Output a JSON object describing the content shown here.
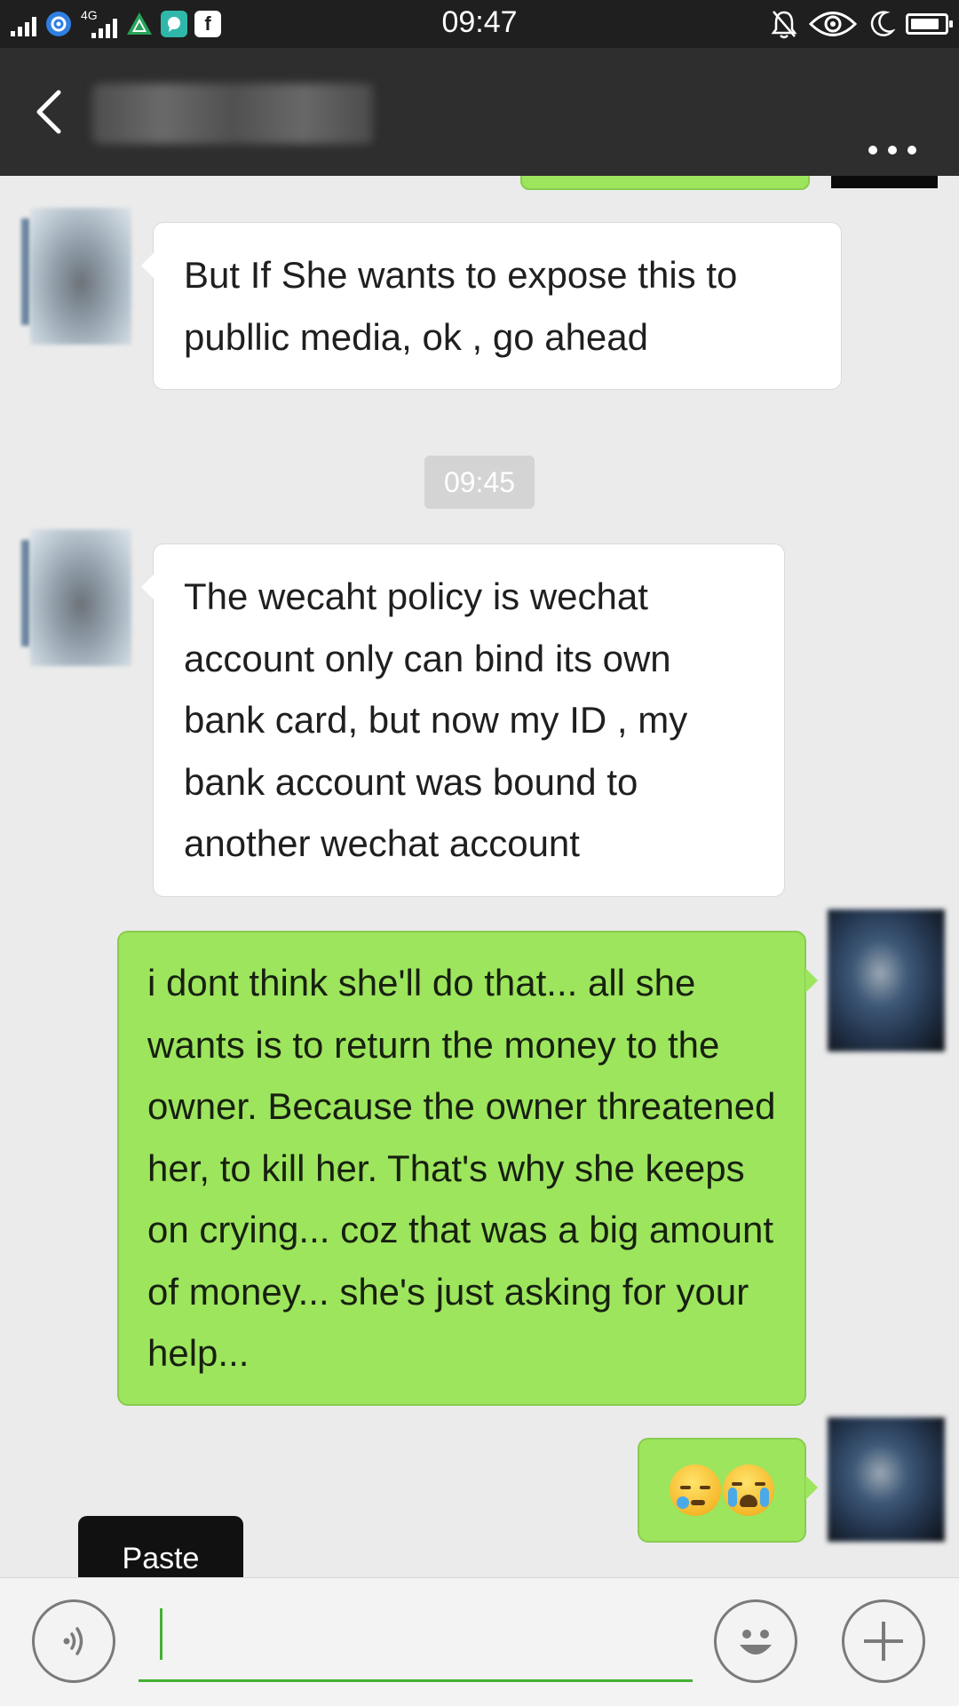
{
  "status_bar": {
    "time": "09:47",
    "network_label": "4G",
    "icons_left": [
      "signal-icon",
      "settings-gear-icon",
      "signal-4g-icon",
      "triangle-app-icon",
      "chat-app-icon",
      "facebook-icon"
    ],
    "icons_right": [
      "mute-bell-icon",
      "eye-icon",
      "moon-icon",
      "battery-icon"
    ],
    "battery_level": 0.85,
    "facebook_glyph": "f"
  },
  "header": {
    "back_icon": "chevron-left-icon",
    "contact_name": "",
    "more_icon": "more-dots-icon"
  },
  "chat": {
    "messages": [
      {
        "sender": "them",
        "text": "But If She wants to expose this to publlic media, ok , go ahead"
      },
      {
        "sender": "system",
        "text": "09:45"
      },
      {
        "sender": "them",
        "text": "The wecaht policy is wechat account only can bind its own bank card, but now my ID , my bank account was bound to another wechat account"
      },
      {
        "sender": "me",
        "text": "i dont think she'll do that... all she wants is to return the money to the owner. Because the owner threatened her, to kill her. That's why she keeps on crying... coz that was a big amount of money... she's just asking for your help..."
      },
      {
        "sender": "me",
        "emoji": [
          "sleepy-face-emoji",
          "loudly-crying-face-emoji"
        ]
      }
    ]
  },
  "context_menu": {
    "paste_label": "Paste"
  },
  "input_bar": {
    "voice_icon": "voice-icon",
    "input_value": "",
    "emoji_icon": "smiley-icon",
    "plus_icon": "plus-icon"
  },
  "colors": {
    "sent_bubble": "#9de55d",
    "received_bubble": "#ffffff",
    "header_bg": "#2e2e2e",
    "status_bg": "#1f1f1f",
    "chat_bg": "#ebebeb",
    "accent_green": "#45b035"
  }
}
